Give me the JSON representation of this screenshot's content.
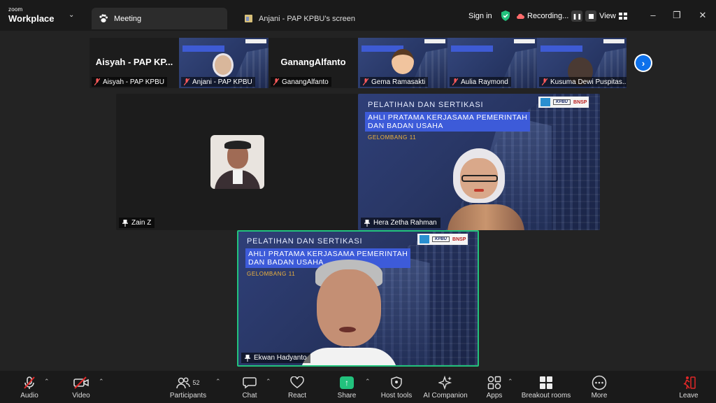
{
  "brand": {
    "line1": "zoom",
    "line2": "Workplace"
  },
  "tabs": [
    {
      "label": "Meeting"
    },
    {
      "label": "Anjani -  PAP KPBU's screen"
    }
  ],
  "header": {
    "sign_in": "Sign in",
    "recording_label": "Recording...",
    "view_label": "View"
  },
  "strip": [
    {
      "name": "Aisyah - PAP KPBU",
      "big_name": "Aisyah  - PAP KP...",
      "type": "name"
    },
    {
      "name": "Anjani -  PAP KPBU",
      "type": "slide"
    },
    {
      "name": "GanangAlfanto",
      "big_name": "GanangAlfanto",
      "type": "name"
    },
    {
      "name": "Gema Ramasakti",
      "type": "slide"
    },
    {
      "name": "Aulia Raymond",
      "type": "slide"
    },
    {
      "name": "Kusuma Dewi Puspitas...",
      "type": "slide"
    }
  ],
  "tiles": {
    "zain": {
      "name": "Zain Z"
    },
    "hera": {
      "name": "Hera  Zetha Rahman"
    },
    "ekwan": {
      "name": "Ekwan Hadyanto"
    }
  },
  "slide": {
    "heading": "PELATIHAN DAN SERTIKASI",
    "band_line1": "AHLI PRATAMA KERJASAMA PEMERINTAH",
    "band_line2": "DAN BADAN USAHA",
    "gelombang": "GELOMBANG 11",
    "logo_kpbu": "KPBU",
    "logo_bnsp": "BNSP"
  },
  "toolbar": {
    "audio": "Audio",
    "video": "Video",
    "participants": "Participants",
    "participants_count": "52",
    "chat": "Chat",
    "react": "React",
    "share": "Share",
    "host_tools": "Host tools",
    "ai_companion": "AI Companion",
    "apps": "Apps",
    "breakout_rooms": "Breakout rooms",
    "more": "More",
    "leave": "Leave"
  },
  "colors": {
    "accent_green": "#22c27d",
    "accent_blue": "#0e71eb",
    "leave_red": "#e02828",
    "slide_band": "#3d5bd9",
    "gelombang": "#f0b43c"
  }
}
